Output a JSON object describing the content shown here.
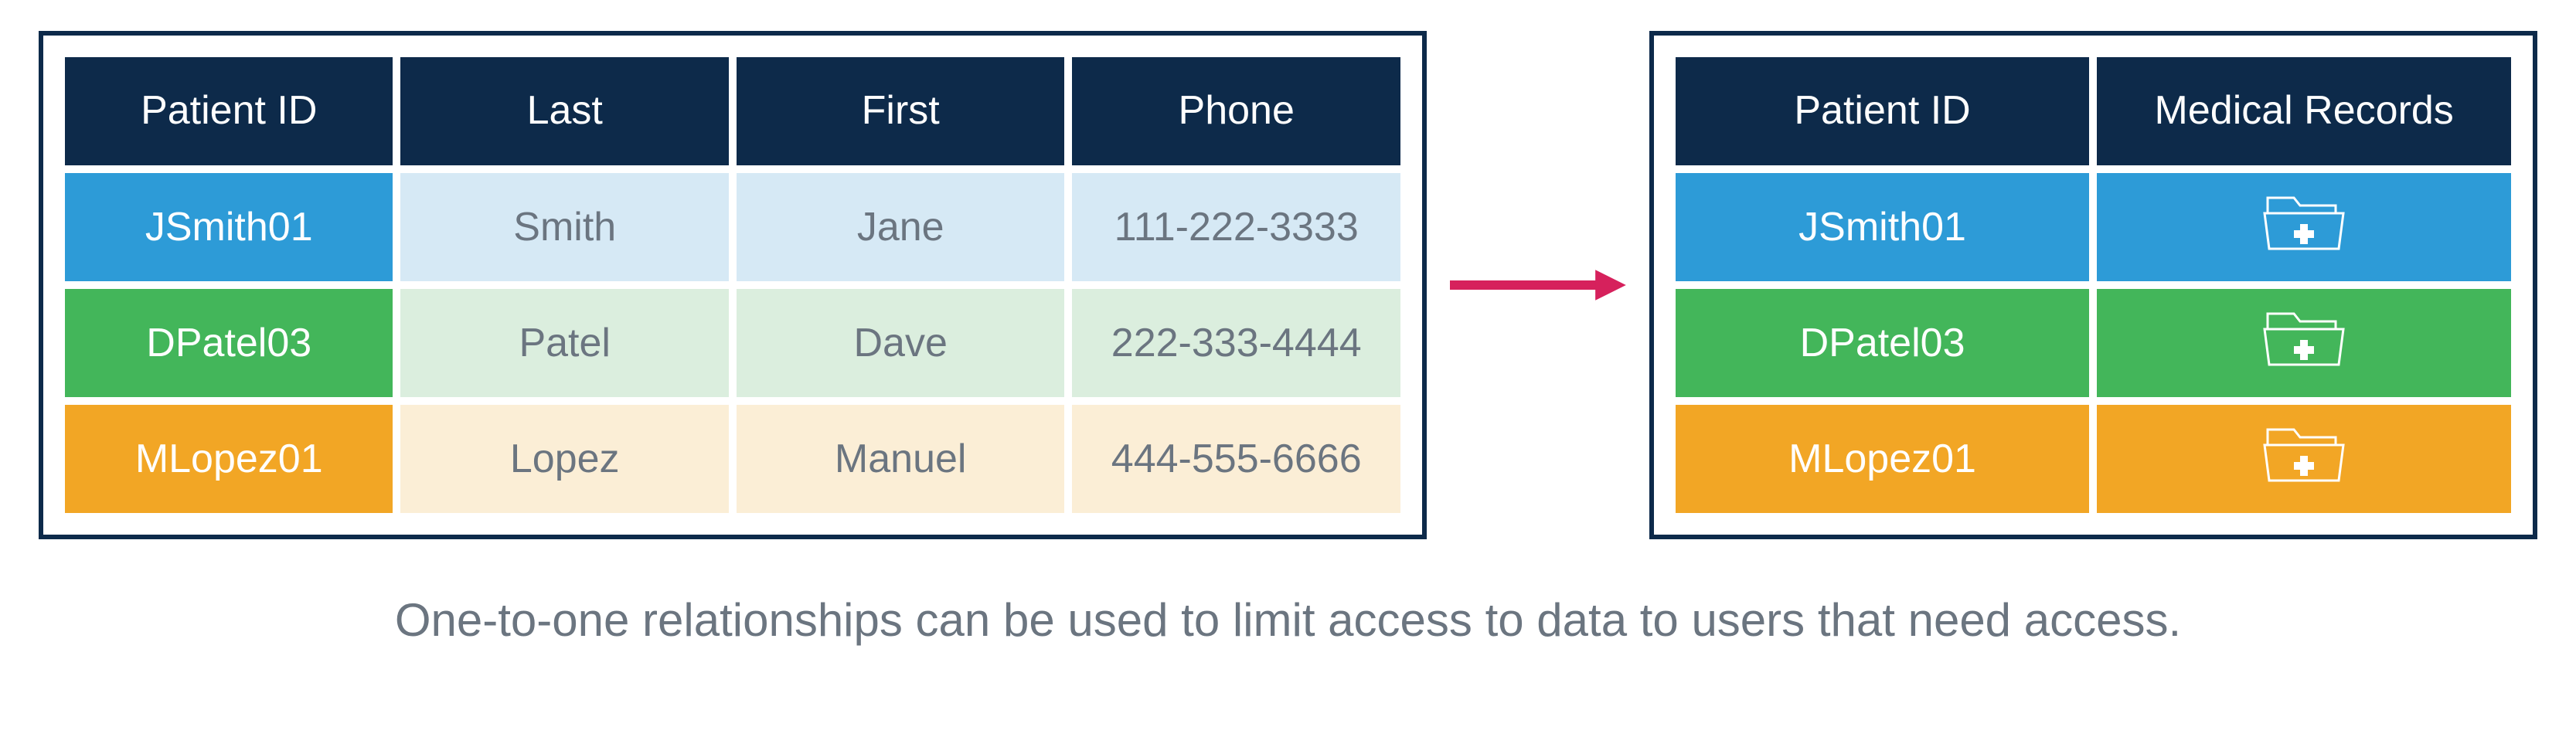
{
  "tables": {
    "left": {
      "headers": [
        "Patient ID",
        "Last",
        "First",
        "Phone"
      ],
      "rows": [
        {
          "color": "blue",
          "patient_id": "JSmith01",
          "last": "Smith",
          "first": "Jane",
          "phone": "111-222-3333"
        },
        {
          "color": "green",
          "patient_id": "DPatel03",
          "last": "Patel",
          "first": "Dave",
          "phone": "222-333-4444"
        },
        {
          "color": "orange",
          "patient_id": "MLopez01",
          "last": "Lopez",
          "first": "Manuel",
          "phone": "444-555-6666"
        }
      ]
    },
    "right": {
      "headers": [
        "Patient ID",
        "Medical Records"
      ],
      "rows": [
        {
          "color": "blue",
          "patient_id": "JSmith01",
          "icon": "medical-folder-icon"
        },
        {
          "color": "green",
          "patient_id": "DPatel03",
          "icon": "medical-folder-icon"
        },
        {
          "color": "orange",
          "patient_id": "MLopez01",
          "icon": "medical-folder-icon"
        }
      ]
    }
  },
  "arrow": {
    "color": "#d6215c",
    "icon": "arrow-right-icon"
  },
  "caption": "One-to-one relationships can be used to limit access to data to users that need access.",
  "colors": {
    "header_bg": "#0d2a4a",
    "blue": "#2d9bd7",
    "green": "#43b65a",
    "orange": "#f2a625"
  }
}
